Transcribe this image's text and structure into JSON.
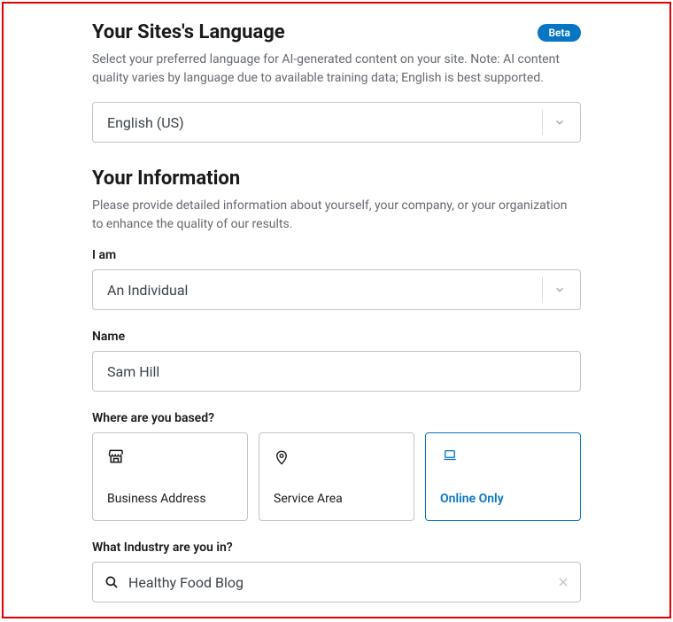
{
  "language": {
    "title": "Your Sites's Language",
    "badge": "Beta",
    "desc": "Select your preferred language for AI-generated content on your site. Note: AI content quality varies by language due to available training data; English is best supported.",
    "value": "English (US)"
  },
  "info": {
    "title": "Your Information",
    "desc": "Please provide detailed information about yourself, your company, or your organization to enhance the quality of our results.",
    "iam": {
      "label": "I am",
      "value": "An Individual"
    },
    "name": {
      "label": "Name",
      "value": "Sam Hill"
    },
    "based": {
      "label": "Where are you based?",
      "options": [
        "Business Address",
        "Service Area",
        "Online Only"
      ]
    },
    "industry": {
      "label": "What Industry are you in?",
      "value": "Healthy Food Blog"
    }
  }
}
